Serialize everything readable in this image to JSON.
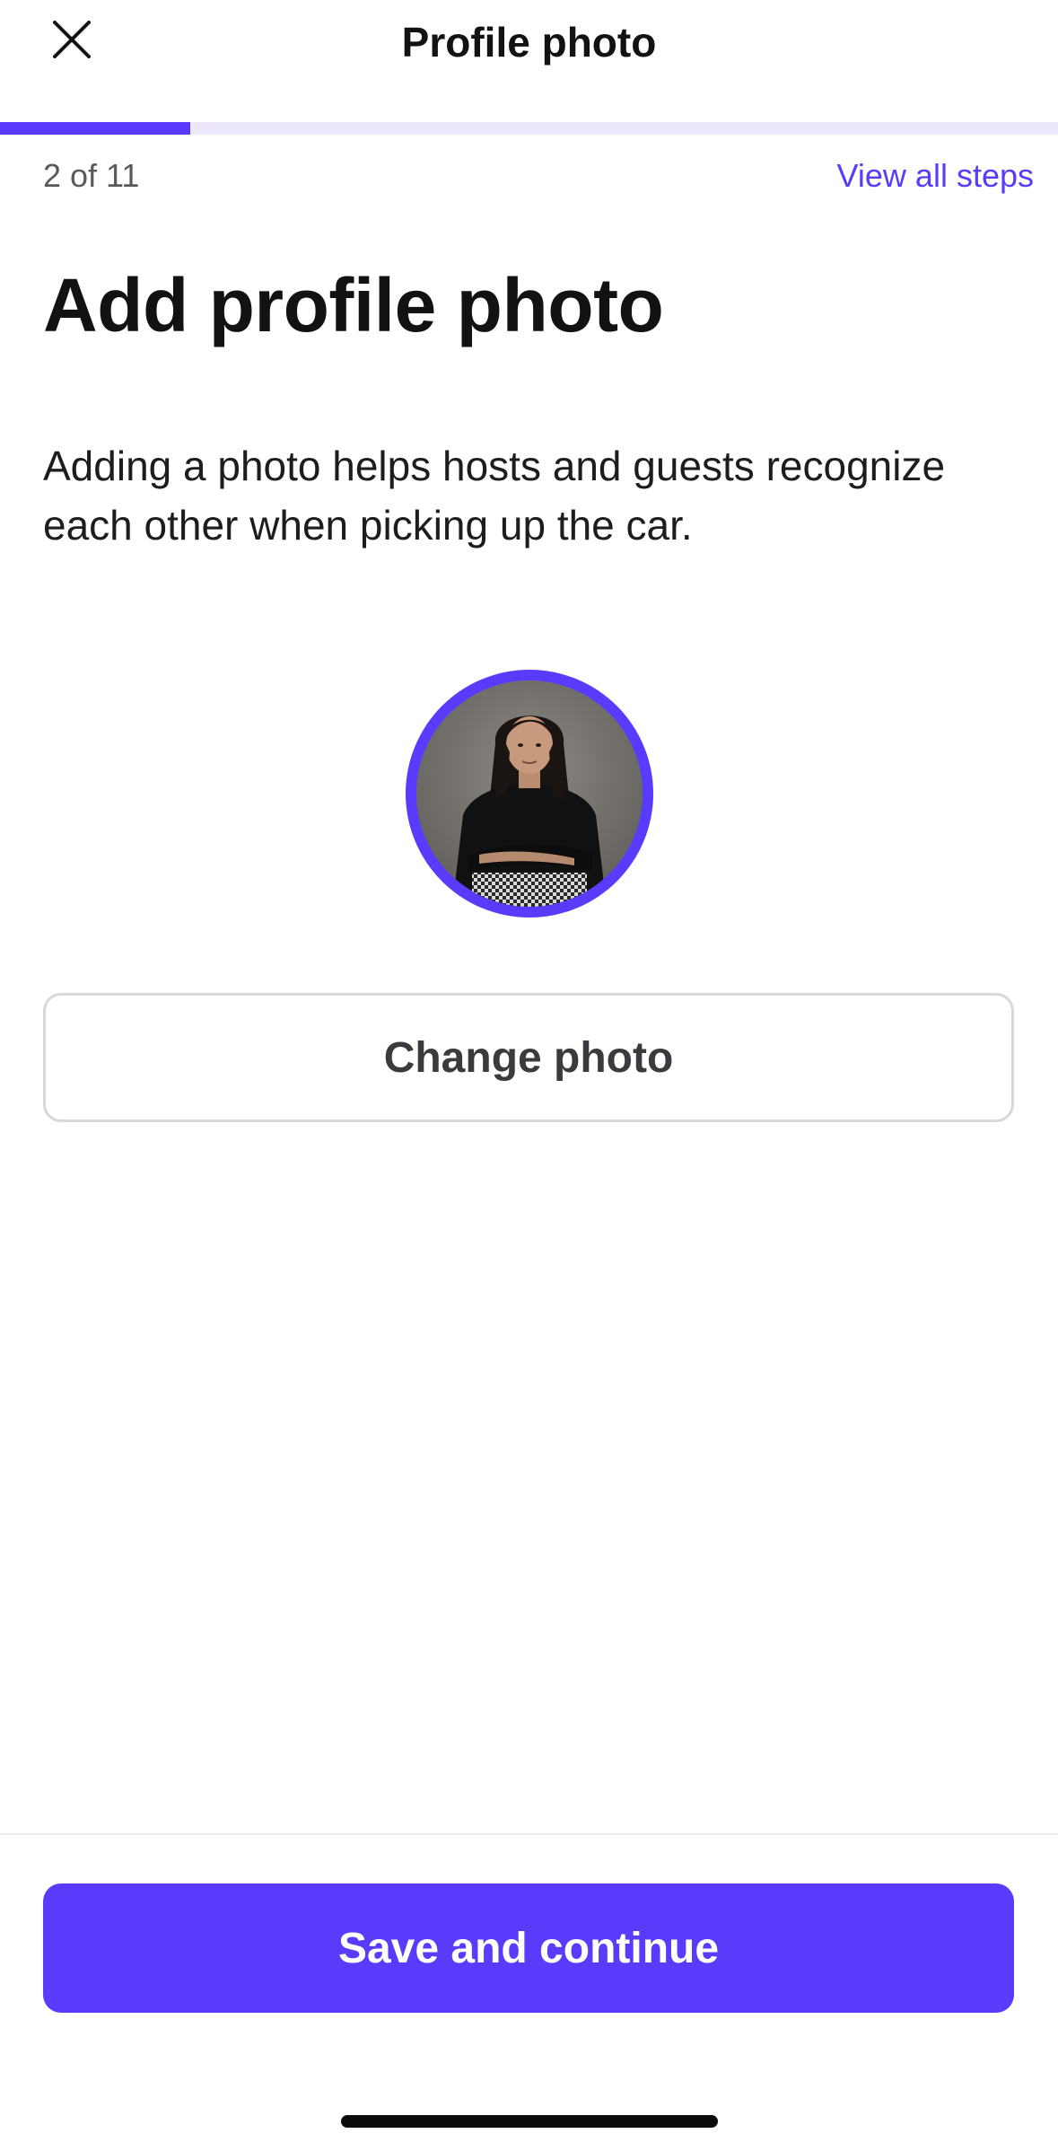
{
  "header": {
    "title": "Profile photo",
    "close_icon": "close-icon"
  },
  "progress": {
    "step_label": "2 of 11",
    "current_step": 2,
    "total_steps": 11,
    "fraction": 0.18,
    "view_all_label": "View all steps"
  },
  "main": {
    "title": "Add profile photo",
    "description": "Adding a photo helps hosts and guests recognize each other when picking up the car.",
    "avatar_icon": "profile-photo",
    "change_photo_label": "Change photo"
  },
  "footer": {
    "primary_label": "Save and continue"
  },
  "colors": {
    "accent": "#593cfb",
    "progress_track": "#ece7fb",
    "text_primary": "#121214",
    "text_secondary": "#5a5a5e",
    "border": "#d8d8dc"
  }
}
